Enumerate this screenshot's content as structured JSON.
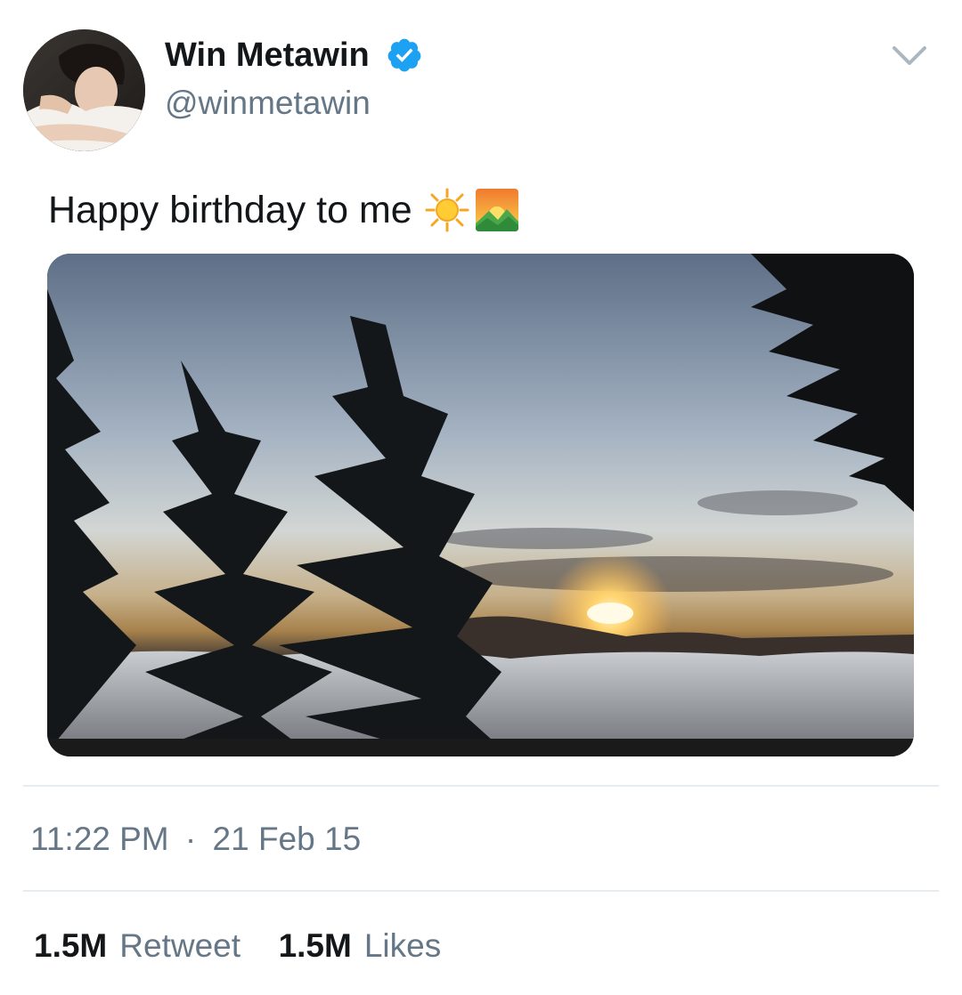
{
  "user": {
    "display_name": "Win Metawin",
    "handle": "@winmetawin",
    "verified": true,
    "avatar_icon": "profile-photo"
  },
  "tweet": {
    "text": "Happy birthday to me",
    "emojis": [
      "sun-icon",
      "sunrise-over-mountains-icon"
    ],
    "media_description": "sunset-photo"
  },
  "meta": {
    "time": "11:22 PM",
    "separator": "·",
    "date": "21 Feb 15"
  },
  "stats": {
    "retweets_count": "1.5M",
    "retweets_label": "Retweet",
    "likes_count": "1.5M",
    "likes_label": "Likes"
  },
  "colors": {
    "verified_blue": "#1da1f2",
    "secondary_text": "#657786",
    "primary_text": "#14171a",
    "divider": "#e6ecf0"
  }
}
